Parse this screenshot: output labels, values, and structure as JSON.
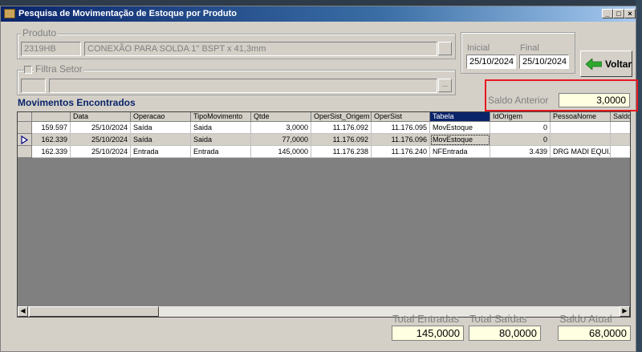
{
  "window": {
    "title": "Pesquisa de Movimentação de Estoque por Produto",
    "controls": {
      "minimize": "_",
      "maximize": "□",
      "close": "×"
    }
  },
  "produto": {
    "label": "Produto",
    "code": "2319HB",
    "description": "CONEXÃO PARA SOLDA 1\" BSPT x 41,3mm",
    "lookup_button": ""
  },
  "periodo": {
    "inicial_label": "Inicial",
    "inicial_value": "25/10/2024",
    "final_label": "Final",
    "final_value": "25/10/2024"
  },
  "filtra_setor": {
    "label": "Filtra Setor",
    "checked": false,
    "lookup_button": "..."
  },
  "voltar": {
    "label": "Voltar",
    "icon": "green-arrow-left-icon"
  },
  "saldo_anterior": {
    "label": "Saldo Anterior",
    "value": "3,0000",
    "highlight_color": "#e8191f"
  },
  "movimentos": {
    "title": "Movimentos Encontrados",
    "columns": [
      "",
      "Data",
      "Operacao",
      "TipoMovimento",
      "Qtde",
      "OperSist_Origem",
      "OperSist",
      "Tabela",
      "IdOrigem",
      "PessoaNome",
      "Saldo"
    ],
    "rows": [
      [
        "159.597",
        "25/10/2024",
        "Saída",
        "Saida",
        "3,0000",
        "11.176.092",
        "11.176.095",
        "MovEstoque",
        "0",
        "",
        ""
      ],
      [
        "162.339",
        "25/10/2024",
        "Saída",
        "Saida",
        "77,0000",
        "11.176.092",
        "11.176.096",
        "MovEstoque",
        "0",
        "",
        ""
      ],
      [
        "162.339",
        "25/10/2024",
        "Entrada",
        "Entrada",
        "145,0000",
        "11.176.238",
        "11.176.240",
        "NFEntrada",
        "3.439",
        "DRG MADI EQUI...",
        ""
      ]
    ],
    "current_row": 1,
    "selected_column": "Tabela"
  },
  "totais": {
    "entradas_label": "Total Entradas",
    "entradas_value": "145,0000",
    "saidas_label": "Total Saídas",
    "saidas_value": "80,0000",
    "atual_label": "Saldo Atual",
    "atual_value": "68,0000"
  }
}
